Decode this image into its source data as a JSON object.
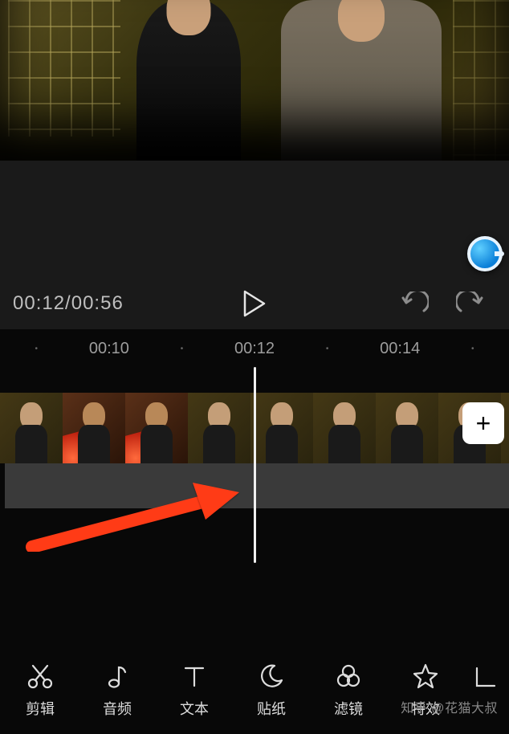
{
  "playback": {
    "current_time": "00:12",
    "total_time": "00:56",
    "display": "00:12/00:56"
  },
  "bubble_color": "#1a93e6",
  "ruler": {
    "marks": [
      "00:10",
      "00:12",
      "00:14"
    ]
  },
  "annotation": {
    "arrow_color": "#ff3a17"
  },
  "add_button": {
    "symbol": "+"
  },
  "toolbar": {
    "items": [
      {
        "id": "cut",
        "label": "剪辑",
        "icon": "scissors-icon"
      },
      {
        "id": "audio",
        "label": "音频",
        "icon": "music-note-icon"
      },
      {
        "id": "text",
        "label": "文本",
        "icon": "text-icon"
      },
      {
        "id": "sticker",
        "label": "贴纸",
        "icon": "moon-icon"
      },
      {
        "id": "filter",
        "label": "滤镜",
        "icon": "overlap-circles-icon"
      },
      {
        "id": "effect",
        "label": "特效",
        "icon": "star-icon"
      }
    ]
  },
  "watermark": "知乎 @花猫大叔",
  "icons": {
    "play": "play-icon",
    "undo": "undo-icon",
    "redo": "redo-icon",
    "add": "plus-icon"
  }
}
